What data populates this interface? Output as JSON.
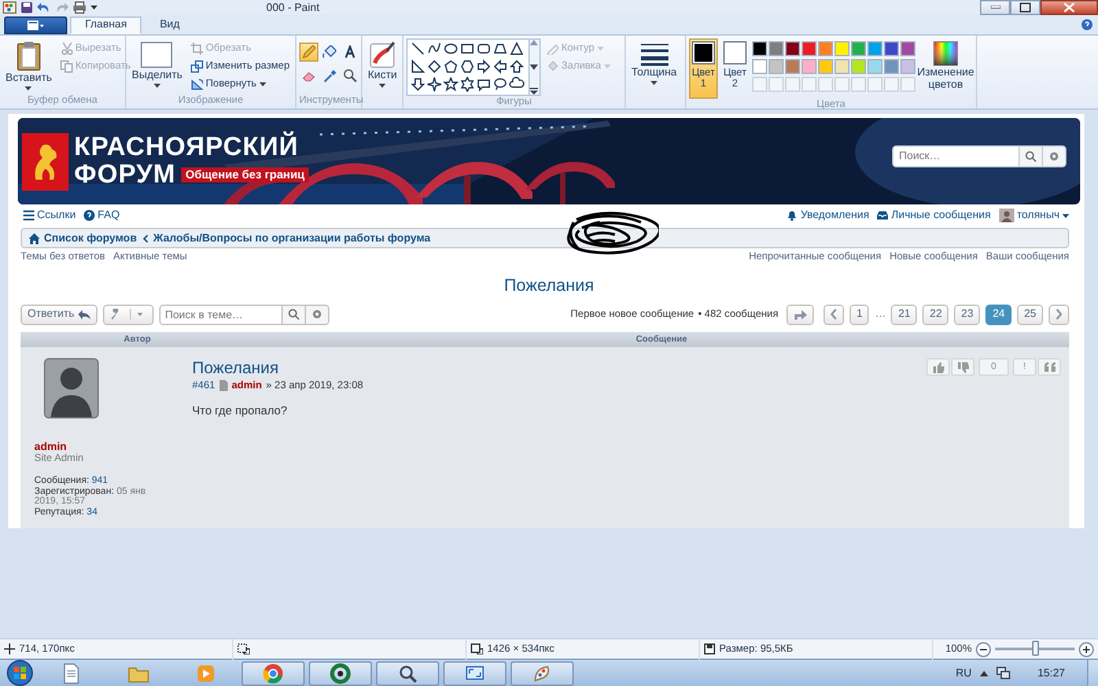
{
  "window": {
    "title": "000 - Paint"
  },
  "ribbon_tabs": [
    {
      "label": "Главная",
      "selected": true
    },
    {
      "label": "Вид",
      "selected": false
    }
  ],
  "clipboard": {
    "label": "Буфер обмена",
    "paste": "Вставить",
    "actions": [
      {
        "kind": "cut",
        "label": "Вырезать",
        "disabled": true
      },
      {
        "kind": "copy",
        "label": "Копировать",
        "disabled": true
      }
    ]
  },
  "image": {
    "label": "Изображение",
    "select": "Выделить",
    "actions": [
      {
        "kind": "crop",
        "label": "Обрезать",
        "disabled": true
      },
      {
        "kind": "resize",
        "label": "Изменить размер",
        "disabled": false
      },
      {
        "kind": "rotate",
        "label": "Повернуть",
        "disabled": false
      }
    ]
  },
  "tools": {
    "label": "Инструменты",
    "items": [
      {
        "kind": "pencil",
        "selected": true
      },
      {
        "kind": "fill",
        "selected": false
      },
      {
        "kind": "text",
        "selected": false
      },
      {
        "kind": "eraser",
        "selected": false
      },
      {
        "kind": "picker",
        "selected": false
      },
      {
        "kind": "magnifier",
        "selected": false
      }
    ]
  },
  "brushes": {
    "label": "Кисти"
  },
  "shapes": {
    "label": "Фигуры",
    "options": [
      {
        "kind": "outline",
        "label": "Контур",
        "disabled": true
      },
      {
        "kind": "fill",
        "label": "Заливка",
        "disabled": true
      }
    ]
  },
  "size": {
    "label": "Толщина"
  },
  "colors": {
    "label": "Цвета",
    "slots": [
      {
        "label": "Цвет 1",
        "color": "#000000",
        "selected": true
      },
      {
        "label": "Цвет 2",
        "color": "#ffffff",
        "selected": false
      }
    ],
    "palette": [
      {
        "color": "#000000"
      },
      {
        "color": "#7f7f7f"
      },
      {
        "color": "#880015"
      },
      {
        "color": "#ed1c24"
      },
      {
        "color": "#ff7f27"
      },
      {
        "color": "#fff200"
      },
      {
        "color": "#22b14c"
      },
      {
        "color": "#00a2e8"
      },
      {
        "color": "#3f48cc"
      },
      {
        "color": "#a349a4"
      },
      {
        "color": "#ffffff"
      },
      {
        "color": "#c3c3c3"
      },
      {
        "color": "#b97a57"
      },
      {
        "color": "#ffaec9"
      },
      {
        "color": "#ffc90e"
      },
      {
        "color": "#efe4b0"
      },
      {
        "color": "#b5e61d"
      },
      {
        "color": "#99d9ea"
      },
      {
        "color": "#7092be"
      },
      {
        "color": "#c8bfe7"
      }
    ],
    "edit": "Изменение цветов"
  },
  "forum": {
    "logo_line1": "КРАСНОЯРСКИЙ",
    "logo_line2": "ФОРУМ",
    "slogan": "Общение без границ",
    "search_placeholder": "Поиск…",
    "nav_left": [
      {
        "kind": "menu",
        "label": "Ссылки"
      },
      {
        "kind": "help",
        "label": "FAQ"
      }
    ],
    "nav_right": [
      {
        "kind": "bell",
        "label": "Уведомления"
      },
      {
        "kind": "inbox",
        "label": "Личные сообщения"
      }
    ],
    "user": "толяныч",
    "breadcrumbs": [
      "Список форумов",
      "Жалобы/Вопросы по организации работы форума"
    ],
    "quick_left": [
      "Темы без ответов",
      "Активные темы"
    ],
    "quick_right": [
      "Непрочитанные сообщения",
      "Новые сообщения",
      "Ваши сообщения"
    ],
    "topic_title": "Пожелания",
    "reply": "Ответить",
    "topic_search_placeholder": "Поиск в теме…",
    "first_new": "Первое новое сообщение",
    "post_count": "• 482 сообщения",
    "pages": [
      {
        "kind": "page",
        "label": "1",
        "selected": false
      },
      {
        "kind": "gap",
        "label": "…",
        "selected": false
      },
      {
        "kind": "page",
        "label": "21",
        "selected": false
      },
      {
        "kind": "page",
        "label": "22",
        "selected": false
      },
      {
        "kind": "page",
        "label": "23",
        "selected": false
      },
      {
        "kind": "page",
        "label": "24",
        "selected": true
      },
      {
        "kind": "page",
        "label": "25",
        "selected": false
      }
    ],
    "columns": [
      "Автор",
      "Сообщение"
    ],
    "post": {
      "author": "admin",
      "rank": "Site Admin",
      "stats": [
        {
          "label": "Сообщения:",
          "value": "941"
        },
        {
          "label": "Зарегистрирован:",
          "value": "05 янв 2019, 15:57"
        },
        {
          "label": "Репутация:",
          "value": "34"
        }
      ],
      "title": "Пожелания",
      "number": "#461",
      "by": "admin",
      "date": "» 23 апр 2019, 23:08",
      "body": "Что где пропало?",
      "votes": "0",
      "report": "!"
    }
  },
  "status": {
    "cursor": "714, 170пкс",
    "image_size": "1426 × 534пкс",
    "file_size": "Размер: 95,5КБ",
    "zoom": "100%",
    "zoom_slider": {
      "level": 0.5
    }
  },
  "taskbar": {
    "apps": [
      {
        "kind": "document",
        "running": false
      },
      {
        "kind": "folder",
        "running": false
      },
      {
        "kind": "media",
        "running": false
      },
      {
        "kind": "browser",
        "running": true
      },
      {
        "kind": "circle",
        "running": true
      },
      {
        "kind": "magnifier",
        "running": true
      },
      {
        "kind": "screen",
        "running": true
      },
      {
        "kind": "paint",
        "running": true
      }
    ],
    "language": "RU",
    "time": "15:27"
  }
}
